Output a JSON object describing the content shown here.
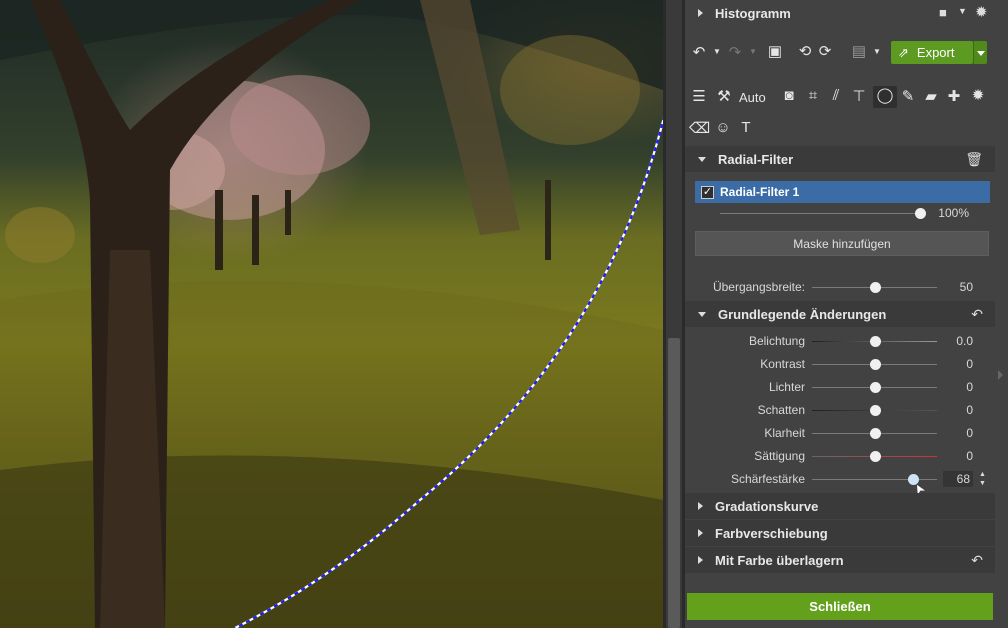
{
  "header": {
    "histogram_label": "Histogramm"
  },
  "toolbar": {
    "export_label": "Export",
    "auto_label": "Auto"
  },
  "radial_filter": {
    "section_title": "Radial-Filter",
    "item_name": "Radial-Filter 1",
    "item_checked": true,
    "opacity_value": "100%",
    "opacity_fraction": 1.0,
    "add_mask_label": "Maske hinzufügen",
    "transition_label": "Übergangsbreite:",
    "transition_value": "50",
    "transition_fraction": 0.5
  },
  "basic": {
    "section_title": "Grundlegende Änderungen",
    "sliders": [
      {
        "label": "Belichtung",
        "value": "0.0",
        "fraction": 0.5
      },
      {
        "label": "Kontrast",
        "value": "0",
        "fraction": 0.5
      },
      {
        "label": "Lichter",
        "value": "0",
        "fraction": 0.5
      },
      {
        "label": "Schatten",
        "value": "0",
        "fraction": 0.5
      },
      {
        "label": "Klarheit",
        "value": "0",
        "fraction": 0.5
      },
      {
        "label": "Sättigung",
        "value": "0",
        "fraction": 0.5
      },
      {
        "label": "Schärfestärke",
        "value": "68",
        "fraction": 0.81
      }
    ]
  },
  "collapsed_sections": [
    {
      "title": "Gradationskurve"
    },
    {
      "title": "Farbverschiebung"
    },
    {
      "title": "Mit Farbe überlagern"
    }
  ],
  "close_label": "Schließen",
  "colors": {
    "accent_green": "#63a11d",
    "selection_blue": "#3b6ca6",
    "mask_outline": "#1a1aff"
  }
}
